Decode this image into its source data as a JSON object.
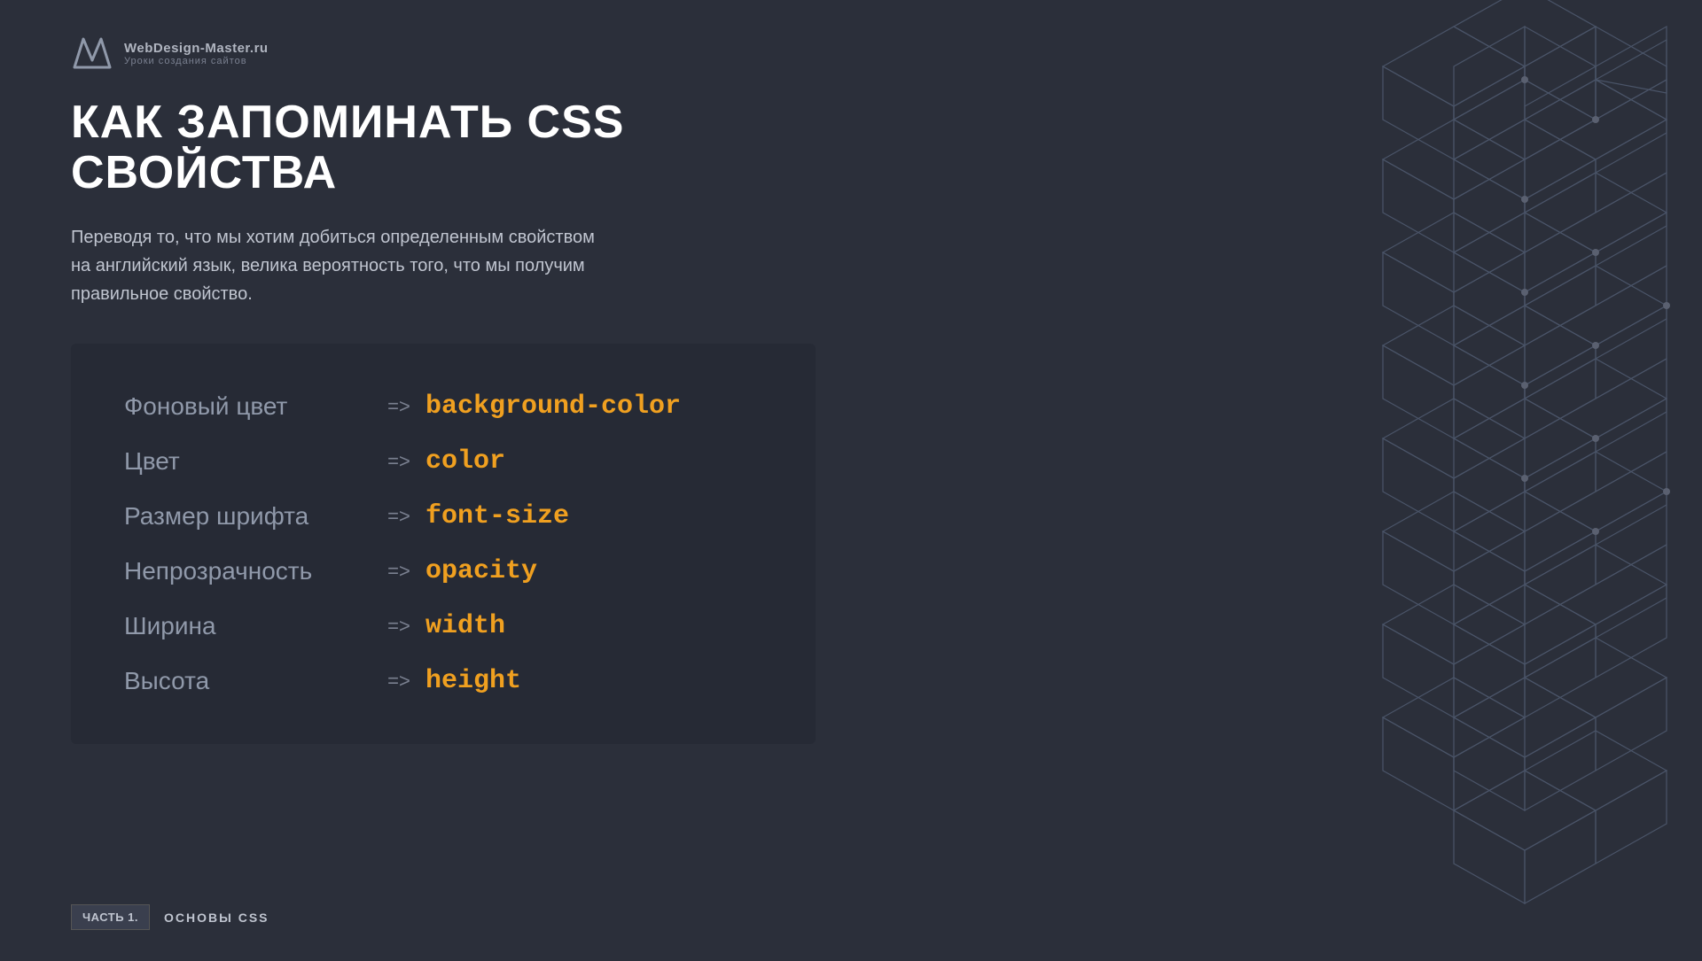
{
  "logo": {
    "title": "WebDesign-Master.ru",
    "subtitle": "Уроки создания сайтов"
  },
  "heading": "КАК ЗАПОМИНАТЬ CSS СВОЙСТВА",
  "description": "Переводя то, что мы хотим добиться определенным свойством\nна английский язык, велика вероятность того, что мы получим\nправильное свойство.",
  "table": {
    "rows": [
      {
        "russian": "Фоновый цвет",
        "css": "background-color"
      },
      {
        "russian": "Цвет",
        "css": "color"
      },
      {
        "russian": "Размер шрифта",
        "css": "font-size"
      },
      {
        "russian": "Непрозрачность",
        "css": "opacity"
      },
      {
        "russian": "Ширина",
        "css": "width"
      },
      {
        "russian": "Высота",
        "css": "height"
      }
    ],
    "arrow": "=>"
  },
  "footer": {
    "badge": "ЧАСТЬ 1.",
    "label": "ОСНОВЫ CSS"
  },
  "colors": {
    "background": "#2b2f3a",
    "accent": "#f0a020",
    "text_muted": "#9099aa",
    "card_bg": "#22263080"
  }
}
